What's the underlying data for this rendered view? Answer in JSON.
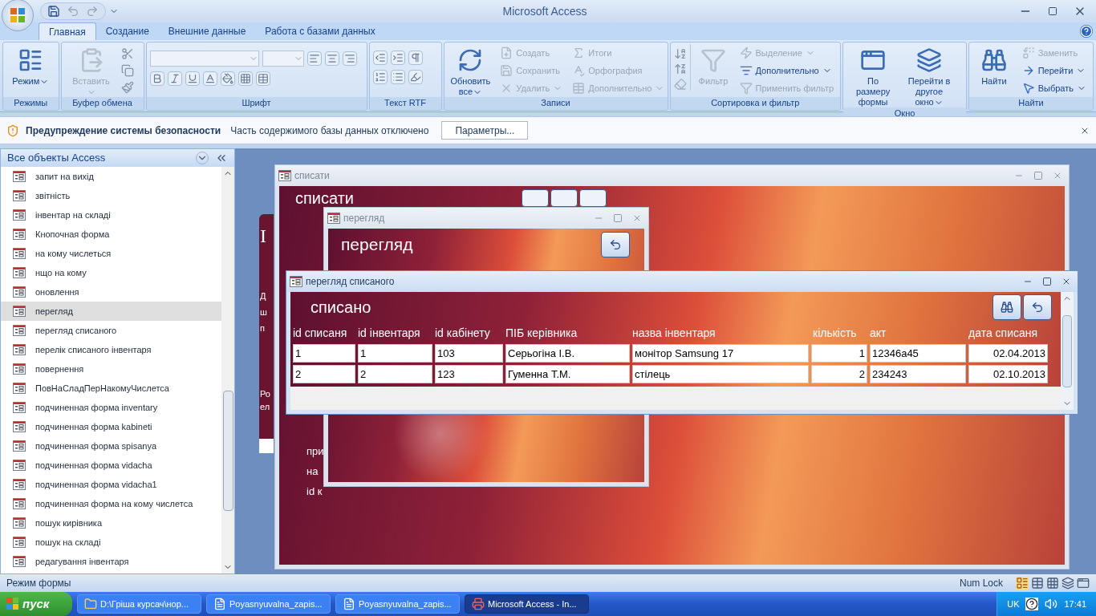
{
  "window": {
    "title": "Microsoft Access"
  },
  "tabs": [
    {
      "label": "Главная",
      "selected": true
    },
    {
      "label": "Создание",
      "selected": false
    },
    {
      "label": "Внешние данные",
      "selected": false
    },
    {
      "label": "Работа с базами данных",
      "selected": false
    }
  ],
  "ribbon": {
    "groups": [
      {
        "label": "Режимы",
        "buttons": [
          {
            "label": "Режим",
            "kind": "large",
            "disabled": false,
            "dropdown": true
          }
        ]
      },
      {
        "label": "Буфер обмена",
        "buttons": [
          {
            "label": "Вставить",
            "kind": "large",
            "disabled": true,
            "dropdown": true
          }
        ]
      },
      {
        "label": "Шрифт"
      },
      {
        "label": "Текст RTF"
      },
      {
        "label": "Записи",
        "buttons": [
          {
            "label": "Обновить все",
            "kind": "large",
            "disabled": false,
            "dropdown": true
          },
          {
            "label": "Создать",
            "kind": "small",
            "disabled": true,
            "dropdown": false
          },
          {
            "label": "Сохранить",
            "kind": "small",
            "disabled": true,
            "dropdown": false
          },
          {
            "label": "Удалить",
            "kind": "small",
            "disabled": true,
            "dropdown": true
          },
          {
            "label": "Итоги",
            "kind": "small",
            "disabled": true,
            "dropdown": false
          },
          {
            "label": "Орфография",
            "kind": "small",
            "disabled": true,
            "dropdown": false
          },
          {
            "label": "Дополнительно",
            "kind": "small",
            "disabled": true,
            "dropdown": true
          }
        ]
      },
      {
        "label": "Сортировка и фильтр",
        "buttons": [
          {
            "label": "Фильтр",
            "kind": "large",
            "disabled": true,
            "dropdown": false
          },
          {
            "label": "Выделение",
            "kind": "small",
            "disabled": true,
            "dropdown": true
          },
          {
            "label": "Дополнительно",
            "kind": "small",
            "disabled": false,
            "dropdown": true
          },
          {
            "label": "Применить фильтр",
            "kind": "small",
            "disabled": true,
            "dropdown": false
          }
        ]
      },
      {
        "label": "Окно",
        "buttons": [
          {
            "label": "По размеру формы",
            "kind": "large",
            "disabled": false,
            "dropdown": false
          },
          {
            "label": "Перейти в другое окно",
            "kind": "large",
            "disabled": false,
            "dropdown": true
          }
        ]
      },
      {
        "label": "Найти",
        "buttons": [
          {
            "label": "Найти",
            "kind": "large",
            "disabled": false,
            "dropdown": false
          },
          {
            "label": "Заменить",
            "kind": "small",
            "disabled": true,
            "dropdown": false
          },
          {
            "label": "Перейти",
            "kind": "small",
            "disabled": false,
            "dropdown": true
          },
          {
            "label": "Выбрать",
            "kind": "small",
            "disabled": false,
            "dropdown": true
          }
        ]
      }
    ]
  },
  "security_bar": {
    "title": "Предупреждение системы безопасности",
    "message": "Часть содержимого базы данных отключено",
    "button": "Параметры..."
  },
  "nav": {
    "title": "Все объекты Access",
    "items": [
      {
        "label": "запит на вихід",
        "selected": false
      },
      {
        "label": "звітність",
        "selected": false
      },
      {
        "label": "інвентар на складі",
        "selected": false
      },
      {
        "label": "Кнопочная форма",
        "selected": false
      },
      {
        "label": "на кому числеться",
        "selected": false
      },
      {
        "label": "нщо на кому",
        "selected": false
      },
      {
        "label": "оновлення",
        "selected": false
      },
      {
        "label": "перегляд",
        "selected": true
      },
      {
        "label": "перегляд списаного",
        "selected": false
      },
      {
        "label": "перелік списаного інвентаря",
        "selected": false
      },
      {
        "label": "повернення",
        "selected": false
      },
      {
        "label": "ПовНаСладПерНакомуЧислетса",
        "selected": false
      },
      {
        "label": "подчиненная форма inventary",
        "selected": false
      },
      {
        "label": "подчиненная форма kabineti",
        "selected": false
      },
      {
        "label": "подчиненная форма spisanya",
        "selected": false
      },
      {
        "label": "подчиненная форма vidacha",
        "selected": false
      },
      {
        "label": "подчиненная форма vidacha1",
        "selected": false
      },
      {
        "label": "подчиненная форма на кому числетса",
        "selected": false
      },
      {
        "label": "пошук кирівника",
        "selected": false
      },
      {
        "label": "пошук на складі",
        "selected": false
      },
      {
        "label": "редагування інвентаря",
        "selected": false
      }
    ]
  },
  "back_form": {
    "fragments": [
      "I",
      "Д",
      "ш",
      "п",
      "Ро",
      "ел"
    ]
  },
  "form_spysaty": {
    "title": "списати",
    "active": false,
    "heading": "списати",
    "fragments": [
      "при",
      "на",
      "id к"
    ]
  },
  "form_pereglyad": {
    "title": "перегляд",
    "active": false,
    "heading": "перегляд"
  },
  "form_spysane": {
    "title": "перегляд списаного",
    "active": true,
    "heading": "списано",
    "table": {
      "columns": [
        {
          "label": "id списаня",
          "kind": "text"
        },
        {
          "label": "id інвентаря",
          "kind": "text"
        },
        {
          "label": "id кабінету",
          "kind": "text"
        },
        {
          "label": "ПІБ керівника",
          "kind": "text"
        },
        {
          "label": "назва інвентаря",
          "kind": "text"
        },
        {
          "label": "кількість",
          "kind": "number"
        },
        {
          "label": "акт",
          "kind": "text"
        },
        {
          "label": "дата списаня",
          "kind": "date"
        }
      ],
      "rows": [
        [
          "1",
          "1",
          "103",
          "Серьогіна І.В.",
          "монітор Samsung 17",
          "1",
          "12346а45",
          "02.04.2013"
        ],
        [
          "2",
          "2",
          "123",
          "Гуменна Т.М.",
          "стілець",
          "2",
          "234243",
          "02.10.2013"
        ]
      ]
    }
  },
  "status_bar": {
    "mode": "Режим формы",
    "num_lock": "Num Lock"
  },
  "taskbar": {
    "start": "пуск",
    "tasks": [
      {
        "label": "D:\\Гріша курсач\\нор...",
        "selected": false
      },
      {
        "label": "Poyasnyuvalna_zapis...",
        "selected": false
      },
      {
        "label": "Poyasnyuvalna_zapis...",
        "selected": false
      },
      {
        "label": "Microsoft Access - In...",
        "selected": true
      }
    ],
    "language": "UK",
    "time": "17:41"
  }
}
